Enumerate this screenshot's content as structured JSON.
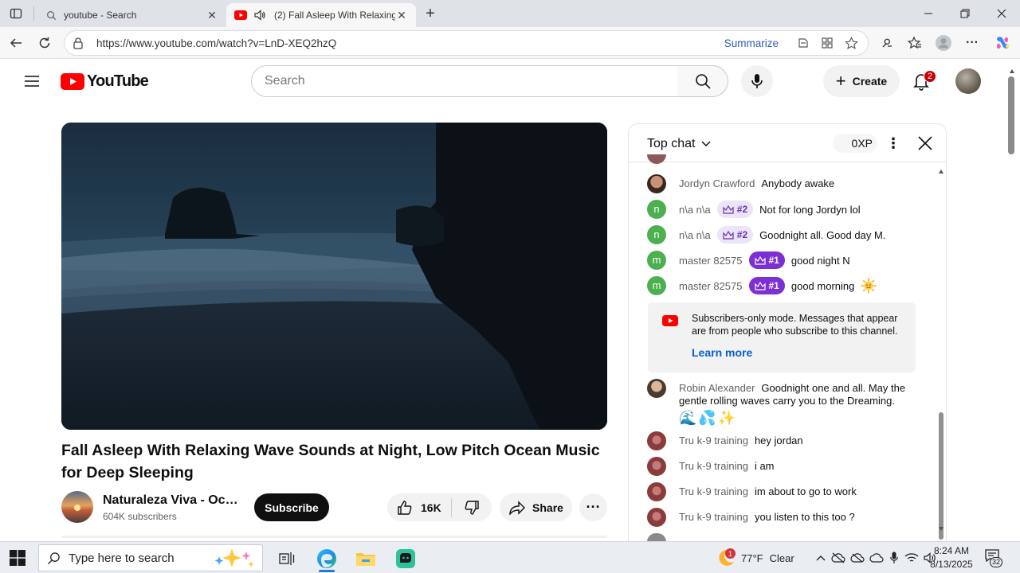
{
  "browser": {
    "tabs": [
      {
        "title": "youtube - Search"
      },
      {
        "title": "(2) Fall Asleep With Relaxing"
      }
    ],
    "url": "https://www.youtube.com/watch?v=LnD-XEQ2hzQ",
    "summarize_label": "Summarize"
  },
  "header": {
    "logo_text": "YouTube",
    "search_placeholder": "Search",
    "create_label": "Create",
    "notifications_count": "2"
  },
  "video": {
    "title": "Fall Asleep With Relaxing Wave Sounds at Night, Low Pitch Ocean Music for Deep Sleeping",
    "channel_name": "Naturaleza Viva - Oce...",
    "subscribers": "604K subscribers",
    "subscribe_label": "Subscribe",
    "likes": "16K",
    "share_label": "Share"
  },
  "chat": {
    "header_label": "Top chat",
    "xp": "0XP",
    "messages": [
      {
        "author": "Jordyn Crawford",
        "text": "Anybody awake"
      },
      {
        "author": "n\\a n\\a",
        "badge": "#2",
        "text": "Not for long Jordyn lol"
      },
      {
        "author": "n\\a n\\a",
        "badge": "#2",
        "text": "Goodnight all. Good day M."
      },
      {
        "author": "master 82575",
        "badge": "#1",
        "text": "good night N"
      },
      {
        "author": "master 82575",
        "badge": "#1",
        "text": "good morning"
      },
      {
        "author": "Robin Alexander",
        "text": "Goodnight one and all. May the gentle rolling waves carry you to the Dreaming."
      },
      {
        "author": "Tru k-9 training",
        "text": "hey jordan"
      },
      {
        "author": "Tru k-9 training",
        "text": "i am"
      },
      {
        "author": "Tru k-9 training",
        "text": "im about to go to work"
      },
      {
        "author": "Tru k-9 training",
        "text": "you listen to this too ?"
      }
    ],
    "subscribers_notice": "Subscribers-only mode. Messages that appear are from people who subscribe to this channel.",
    "learn_more": "Learn more",
    "emoji_line": "🌊💦✨"
  },
  "taskbar": {
    "search_placeholder": "Type here to search",
    "weather": "77°F",
    "weather_desc": "Clear",
    "weather_badge": "1",
    "time": "8:24 AM",
    "date": "8/13/2025",
    "notif_count": "32"
  },
  "colors": {
    "yt_red": "#ff0000",
    "badge_rank1": "#7b2fd4",
    "badge_rank2_bg": "#ece4f7",
    "link_blue": "#065fd4",
    "avatar_green": "#4caf50"
  }
}
